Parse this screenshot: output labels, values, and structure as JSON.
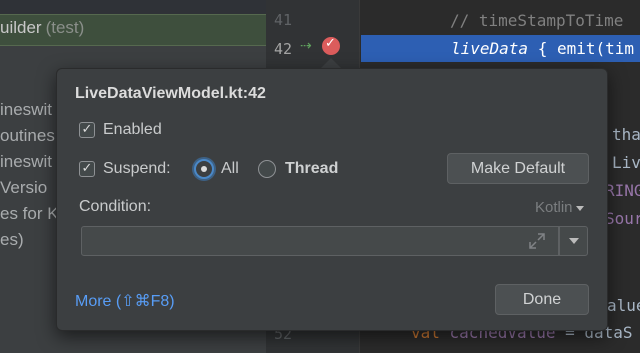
{
  "project_tree": {
    "selected_item": "uilder",
    "selected_suffix": "(test)",
    "partial_lines": [
      "ineswit",
      "outines",
      "ineswit",
      "Versio",
      "es for K",
      "es)"
    ]
  },
  "editor": {
    "line_numbers": {
      "line_41": "41",
      "line_42": "42",
      "line_52": "52"
    },
    "code": {
      "line_41": "// timeStampToTime",
      "line_42_call": "liveData",
      "line_42_rest": " { emit(tim",
      "frag_tha": "tha",
      "frag_liv": "Liv",
      "frag_ring": "RING",
      "frag_sour": "Sour",
      "frag_alue": "alue",
      "line_52_keyword": "val",
      "line_52_var": " cachedValue",
      "line_52_rest": " = dataS"
    }
  },
  "breakpoint_popup": {
    "title": "LiveDataViewModel.kt:42",
    "enabled": {
      "label": "Enabled",
      "checked": true
    },
    "suspend": {
      "label": "Suspend:",
      "checked": true
    },
    "suspend_options": {
      "all": "All",
      "thread": "Thread",
      "selected": "All"
    },
    "make_default_label": "Make Default",
    "condition_label": "Condition:",
    "condition_value": "",
    "language": "Kotlin",
    "more_link": "More (⇧⌘F8)",
    "done_label": "Done"
  },
  "colors": {
    "popup_bg": "#3c3f41",
    "highlight": "#2d5fb3",
    "link": "#589df6",
    "breakpoint": "#db5c5c"
  },
  "icons": {
    "gutter_arrow": "run-to-cursor-arrow-icon",
    "breakpoint": "breakpoint-icon",
    "expand": "expand-icon",
    "dropdown": "chevron-down-icon"
  }
}
